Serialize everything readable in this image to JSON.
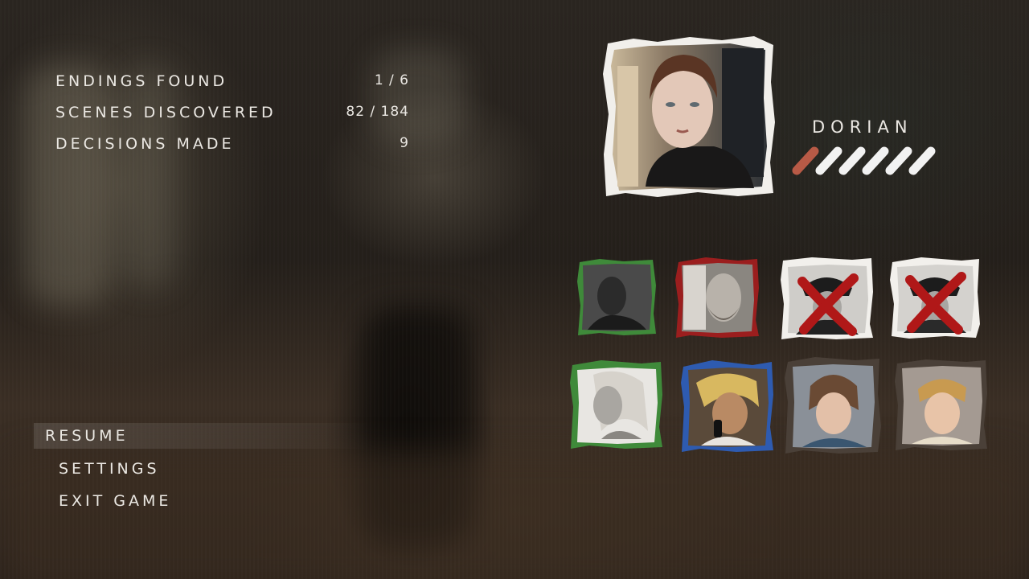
{
  "stats": {
    "endings": {
      "label": "ENDINGS FOUND",
      "value": "1 / 6"
    },
    "scenes": {
      "label": "SCENES DISCOVERED",
      "value": "82 / 184"
    },
    "decisions": {
      "label": "DECISIONS MADE",
      "value": "9"
    }
  },
  "menu": {
    "resume": "RESUME",
    "settings": "SETTINGS",
    "exit": "EXIT GAME"
  },
  "character": {
    "name": "DORIAN",
    "trust_level": 1,
    "trust_max": 6,
    "colors": {
      "filled": "#b85a46",
      "empty": "#f2f2f2"
    }
  },
  "relationships": {
    "colors": {
      "ally": "#3f8a3a",
      "hostile": "#9b1e1e",
      "eliminated": "#b01818",
      "paper": "#f2f0ec"
    },
    "characters": [
      {
        "status": "ally"
      },
      {
        "status": "hostile"
      },
      {
        "status": "eliminated"
      },
      {
        "status": "eliminated"
      },
      {
        "status": "ally"
      },
      {
        "status": "neutral"
      },
      {
        "status": "neutral"
      },
      {
        "status": "neutral"
      }
    ]
  }
}
